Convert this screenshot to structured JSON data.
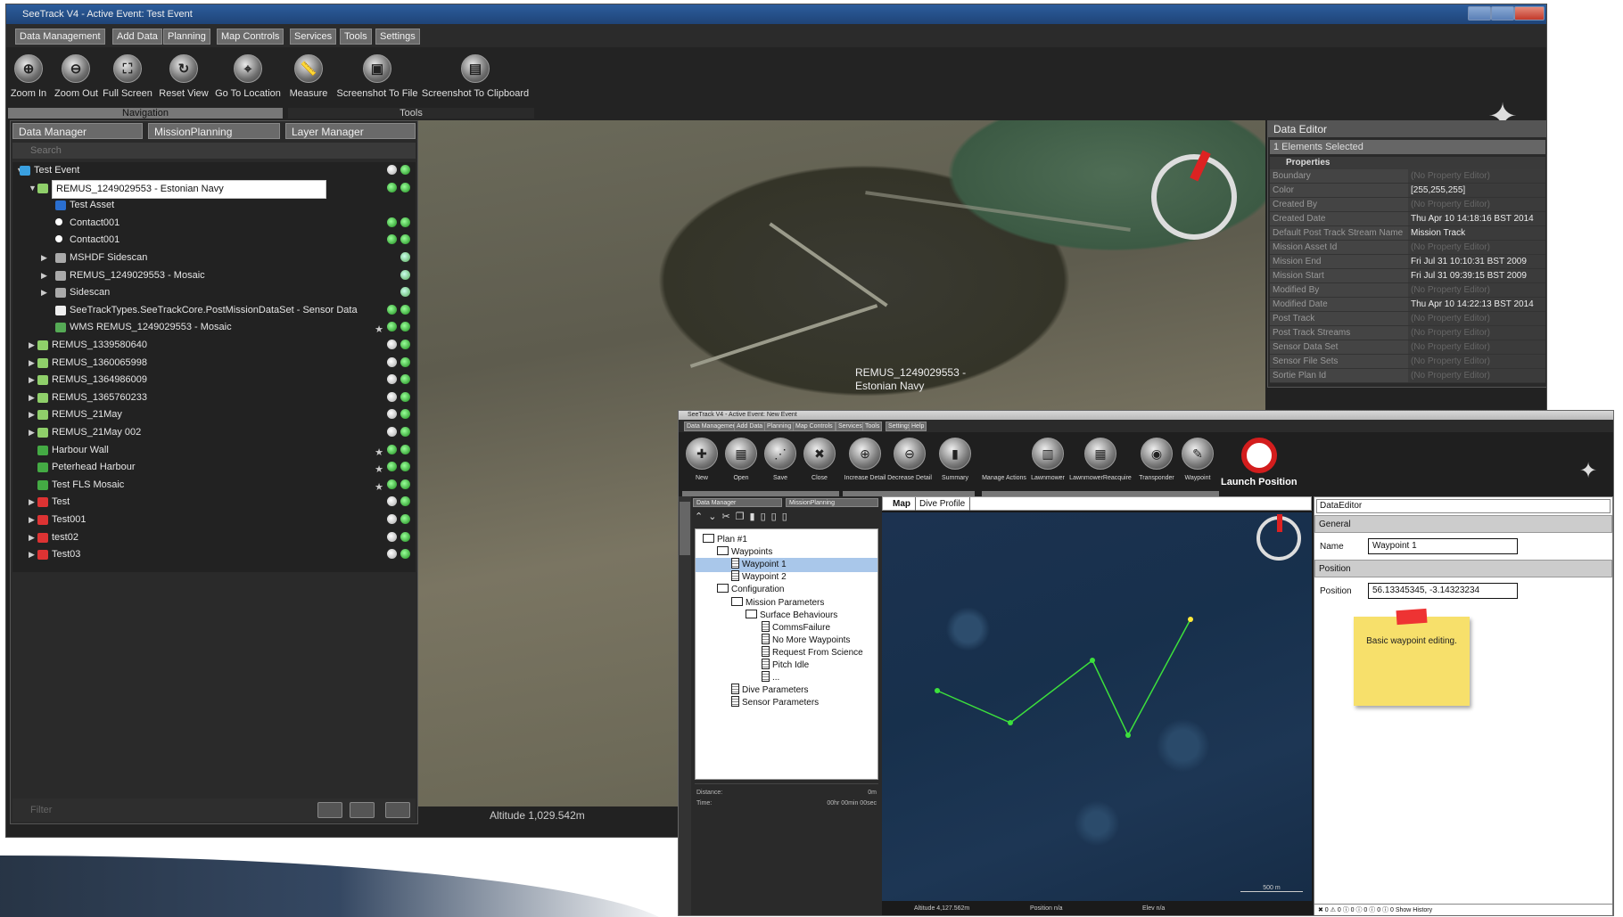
{
  "back_window": {
    "title": "SeeTrack V4 - Active Event: Test Event",
    "menus": [
      "Data Management",
      "Add Data",
      "Planning",
      "Map Controls",
      "Services",
      "Tools",
      "Settings"
    ],
    "navigation_tools": [
      "Zoom In",
      "Zoom Out",
      "Full Screen",
      "Reset View",
      "Go To Location"
    ],
    "navigation_group": "Navigation",
    "other_tools": [
      "Measure",
      "Screenshot To File",
      "Screenshot To Clipboard"
    ],
    "tools_group": "Tools",
    "panel_tabs": [
      "Data Manager",
      "MissionPlanning",
      "Layer Manager"
    ],
    "search_placeholder": "Search",
    "filter_placeholder": "Filter",
    "tree": [
      "Test Event",
      "REMUS_1249029553 - Estonian Navy",
      "Test Asset",
      "Contact001",
      "Contact001",
      "MSHDF Sidescan",
      "REMUS_1249029553 - Mosaic",
      "Sidescan",
      "SeeTrackTypes.SeeTrackCore.PostMissionDataSet - Sensor Data",
      "WMS REMUS_1249029553 - Mosaic",
      "REMUS_1339580640",
      "REMUS_1360065998",
      "REMUS_1364986009",
      "REMUS_1365760233",
      "REMUS_21May",
      "REMUS_21May 002",
      "Harbour Wall",
      "Peterhead Harbour",
      "Test FLS Mosaic",
      "Test",
      "Test001",
      "test02",
      "Test03"
    ],
    "map_label": "REMUS_1249029553 - Estonian Navy",
    "altitude": "Altitude 1,029.542m",
    "data_editor": {
      "title": "Data Editor",
      "selection": "1 Elements Selected",
      "section": "Properties",
      "properties": [
        {
          "k": "Boundary",
          "v": "(No Property Editor)"
        },
        {
          "k": "Color",
          "v": "[255,255,255]"
        },
        {
          "k": "Created By",
          "v": "(No Property Editor)"
        },
        {
          "k": "Created Date",
          "v": "Thu Apr 10 14:18:16 BST 2014"
        },
        {
          "k": "Default Post Track Stream Name",
          "v": "Mission Track"
        },
        {
          "k": "Mission Asset Id",
          "v": "(No Property Editor)"
        },
        {
          "k": "Mission End",
          "v": "Fri Jul 31 10:10:31 BST 2009"
        },
        {
          "k": "Mission Start",
          "v": "Fri Jul 31 09:39:15 BST 2009"
        },
        {
          "k": "Modified By",
          "v": "(No Property Editor)"
        },
        {
          "k": "Modified Date",
          "v": "Thu Apr 10 14:22:13 BST 2014"
        },
        {
          "k": "Post Track",
          "v": "(No Property Editor)"
        },
        {
          "k": "Post Track Streams",
          "v": "(No Property Editor)"
        },
        {
          "k": "Sensor Data Set",
          "v": "(No Property Editor)"
        },
        {
          "k": "Sensor File Sets",
          "v": "(No Property Editor)"
        },
        {
          "k": "Sortie Plan Id",
          "v": "(No Property Editor)"
        }
      ]
    }
  },
  "front_window": {
    "title": "SeeTrack V4 - Active Event: New Event",
    "menus": [
      "Data Management",
      "Add Data",
      "Planning",
      "Map Controls",
      "Services",
      "Tools",
      "Settings",
      "Help"
    ],
    "plans_tools": [
      "New",
      "Open",
      "Save",
      "Close"
    ],
    "information_tools": [
      "Increase Detail",
      "Decrease Detail",
      "Summary"
    ],
    "plan_elements_tools": [
      "Manage Actions",
      "Lawnmower",
      "LawnmowerReacquire",
      "Transponder",
      "Waypoint"
    ],
    "launch_label": "Launch Position",
    "panel_tabs": [
      "Data Manager",
      "MissionPlanning"
    ],
    "side_tab": "Layer Manager",
    "tree": [
      "Plan #1",
      "Waypoints",
      "Waypoint 1",
      "Waypoint 2",
      "Configuration",
      "Mission Parameters",
      "Surface Behaviours",
      "CommsFailure",
      "No More Waypoints",
      "Request From Science",
      "Pitch Idle",
      "...",
      "Dive Parameters",
      "Sensor Parameters"
    ],
    "stats": [
      {
        "k": "Distance:",
        "v": "0m"
      },
      {
        "k": "Time:",
        "v": "00hr 00min 00sec"
      }
    ],
    "map_tabs": [
      "Map",
      "Dive Profile"
    ],
    "scale": "500 m",
    "status": {
      "altitude": "Altitude 4,127.562m",
      "position": "Position n/a",
      "elev": "Elev n/a"
    },
    "data_editor": {
      "title": "DataEditor",
      "general": "General",
      "name_label": "Name",
      "name_value": "Waypoint 1",
      "position_section": "Position",
      "position_label": "Position",
      "position_value": "56.13345345, -3.14323234",
      "note": "Basic waypoint editing.",
      "status_bar": "✖ 0  ⚠ 0  ⓘ 0  ⓘ 0  ⓘ 0  ⓘ 0   Show History"
    }
  },
  "colors": {
    "accent_red": "#d31d1d",
    "selection_blue": "#a9c7ea",
    "track_green": "#3ce03c",
    "sticky": "#f7e06b"
  }
}
